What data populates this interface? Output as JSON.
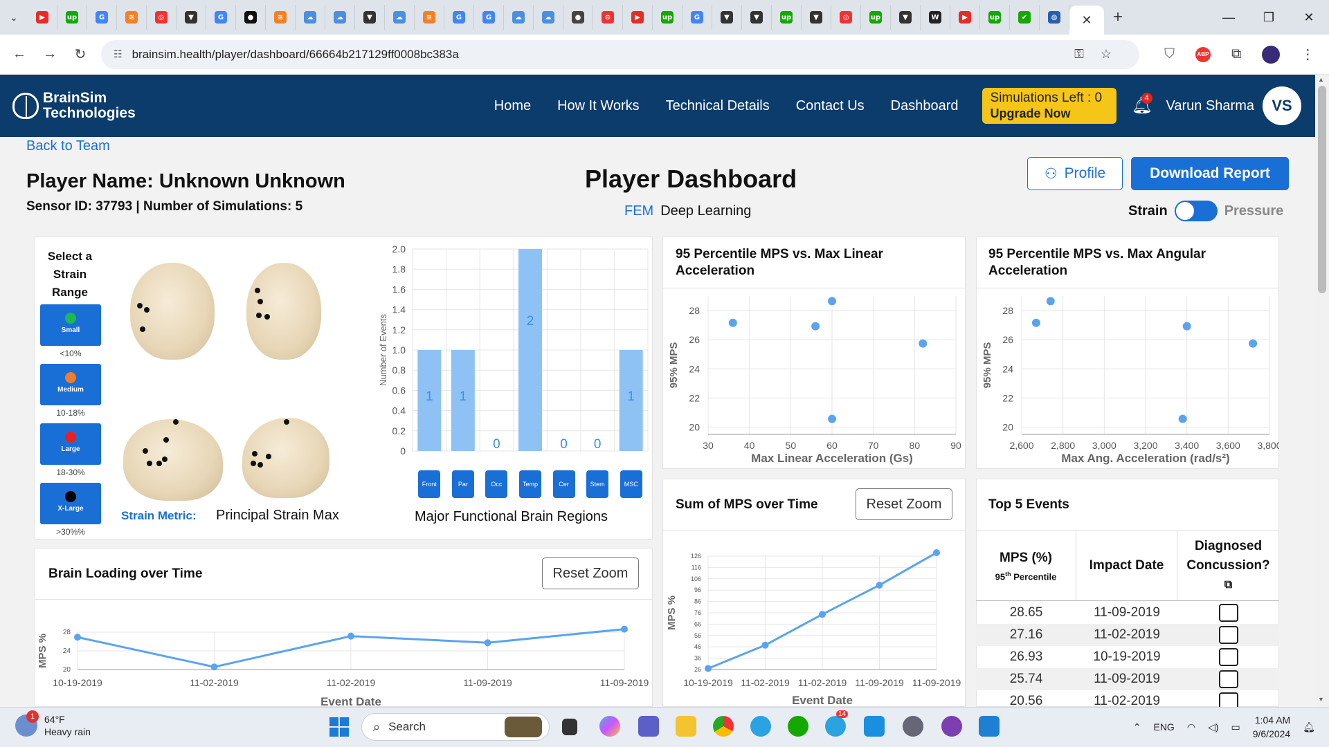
{
  "browser": {
    "url": "brainsim.health/player/dashboard/66664b217129ff0008bc383a",
    "active_tab_close": "✕",
    "new_tab": "+",
    "favicons": [
      {
        "icon": "youtube-icon",
        "color": "#e52d27",
        "glyph": "▶"
      },
      {
        "icon": "upwork-icon",
        "color": "#14a800",
        "glyph": "up"
      },
      {
        "icon": "google-icon",
        "color": "#4285f4",
        "glyph": "G"
      },
      {
        "icon": "stack-icon",
        "color": "#f48024",
        "glyph": "≋"
      },
      {
        "icon": "orbit-icon",
        "color": "#e33",
        "glyph": "◎"
      },
      {
        "icon": "vector-icon",
        "color": "#333",
        "glyph": "▼"
      },
      {
        "icon": "google-icon",
        "color": "#4285f4",
        "glyph": "G"
      },
      {
        "icon": "github-icon",
        "color": "#111",
        "glyph": "●"
      },
      {
        "icon": "stack-icon",
        "color": "#f48024",
        "glyph": "≋"
      },
      {
        "icon": "cloud-icon",
        "color": "#4a8fe0",
        "glyph": "☁"
      },
      {
        "icon": "cloud-icon",
        "color": "#4a8fe0",
        "glyph": "☁"
      },
      {
        "icon": "vector-icon",
        "color": "#333",
        "glyph": "▼"
      },
      {
        "icon": "cloud-icon",
        "color": "#4a8fe0",
        "glyph": "☁"
      },
      {
        "icon": "stack-icon",
        "color": "#f48024",
        "glyph": "≋"
      },
      {
        "icon": "google-icon",
        "color": "#4285f4",
        "glyph": "G"
      },
      {
        "icon": "google-icon",
        "color": "#4285f4",
        "glyph": "G"
      },
      {
        "icon": "cloud-icon",
        "color": "#4a8fe0",
        "glyph": "☁"
      },
      {
        "icon": "cloud-icon",
        "color": "#4a8fe0",
        "glyph": "☁"
      },
      {
        "icon": "globe-icon",
        "color": "#444",
        "glyph": "●"
      },
      {
        "icon": "chat-icon",
        "color": "#e33",
        "glyph": "⊝"
      },
      {
        "icon": "youtube-icon",
        "color": "#e52d27",
        "glyph": "▶"
      },
      {
        "icon": "upwork-icon",
        "color": "#14a800",
        "glyph": "up"
      },
      {
        "icon": "google-icon",
        "color": "#4285f4",
        "glyph": "G"
      },
      {
        "icon": "vector-icon",
        "color": "#333",
        "glyph": "▼"
      },
      {
        "icon": "vector-icon",
        "color": "#333",
        "glyph": "▼"
      },
      {
        "icon": "upwork-icon",
        "color": "#14a800",
        "glyph": "up"
      },
      {
        "icon": "vector-icon",
        "color": "#333",
        "glyph": "▼"
      },
      {
        "icon": "orbit-icon",
        "color": "#e33",
        "glyph": "◎"
      },
      {
        "icon": "upwork-icon",
        "color": "#14a800",
        "glyph": "up"
      },
      {
        "icon": "vector-icon",
        "color": "#333",
        "glyph": "▼"
      },
      {
        "icon": "wikipedia-icon",
        "color": "#222",
        "glyph": "W"
      },
      {
        "icon": "youtube-icon",
        "color": "#e52d27",
        "glyph": "▶"
      },
      {
        "icon": "upwork-icon",
        "color": "#14a800",
        "glyph": "up"
      },
      {
        "icon": "check-icon",
        "color": "#14a800",
        "glyph": "✔"
      },
      {
        "icon": "globe-icon",
        "color": "#2a5db0",
        "glyph": "◍"
      }
    ]
  },
  "header": {
    "logo_line1": "BrainSim",
    "logo_line2": "Technologies",
    "nav": [
      "Home",
      "How It Works",
      "Technical Details",
      "Contact Us",
      "Dashboard"
    ],
    "simulations_left": "Simulations Left : 0",
    "upgrade": "Upgrade Now",
    "notifications": "4",
    "user_name": "Varun Sharma",
    "user_initials": "VS",
    "colors": {
      "bar": "#0b3c6b",
      "accent": "#f5c518",
      "primary": "#1a6fd6"
    }
  },
  "page": {
    "back_link": "Back to Team",
    "player_name": "Player Name: Unknown Unknown",
    "sensor_line": "Sensor ID: 37793 | Number of Simulations: 5",
    "dashboard_title": "Player Dashboard",
    "mode_fem": "FEM",
    "mode_dl": "Deep Learning",
    "profile_btn": "Profile",
    "download_btn": "Download Report",
    "toggle_left": "Strain",
    "toggle_right": "Pressure",
    "toggle_state": "Strain"
  },
  "strain_panel": {
    "select_title": "Select a Strain Range",
    "ranges": [
      {
        "label": "Small",
        "caption": "<10%",
        "color": "#1db954"
      },
      {
        "label": "Medium",
        "caption": "10-18%",
        "color": "#f07d2c"
      },
      {
        "label": "Large",
        "caption": "18-30%",
        "color": "#e82020"
      },
      {
        "label": "X-Large",
        "caption": ">30%%",
        "color": "#000000"
      }
    ],
    "metric_label": "Strain Metric:",
    "metric_value": "Principal Strain Max",
    "regions_caption": "Major Functional Brain Regions",
    "regions": [
      "Front",
      "Par",
      "Occ",
      "Temp",
      "Cer",
      "Stem",
      "MSC"
    ]
  },
  "region_chart": {
    "ylabel": "Number of Events",
    "yticks": [
      "2.0",
      "1.8",
      "1.6",
      "1.4",
      "1.2",
      "1.0",
      "0.8",
      "0.6",
      "0.4",
      "0.2",
      "0"
    ]
  },
  "cards": {
    "linear_title": "95 Percentile MPS vs. Max Linear Acceleration",
    "angular_title": "95 Percentile MPS vs. Max Angular Acceleration",
    "sum_title": "Sum of MPS over Time",
    "loading_title": "Brain Loading over Time",
    "reset_zoom": "Reset Zoom",
    "top5_title": "Top 5 Events"
  },
  "chart_data": [
    {
      "id": "regions",
      "type": "bar",
      "categories": [
        "Front",
        "Par",
        "Occ",
        "Temp",
        "Cer",
        "Stem",
        "MSC"
      ],
      "values": [
        1,
        1,
        0,
        2,
        0,
        0,
        1
      ],
      "ylabel": "Number of Events",
      "ylim": [
        0,
        2
      ]
    },
    {
      "id": "linear",
      "type": "scatter",
      "x": [
        36,
        56,
        60,
        60,
        82
      ],
      "y": [
        27.16,
        26.93,
        28.65,
        20.56,
        25.74
      ],
      "xlabel": "Max Linear Acceleration (Gs)",
      "ylabel": "95% MPS",
      "xticks": [
        "30",
        "40",
        "50",
        "60",
        "70",
        "80",
        "90"
      ],
      "yticks": [
        "28",
        "26",
        "24",
        "22",
        "20"
      ],
      "xlim": [
        30,
        90
      ],
      "ylim": [
        19.5,
        29
      ]
    },
    {
      "id": "angular",
      "type": "scatter",
      "x": [
        2670,
        2740,
        3380,
        3400,
        3720
      ],
      "y": [
        27.16,
        28.65,
        20.56,
        26.93,
        25.74
      ],
      "xlabel": "Max Ang. Acceleration (rad/s²)",
      "ylabel": "95% MPS",
      "xticks": [
        "2,600",
        "2,800",
        "3,000",
        "3,200",
        "3,400",
        "3,600",
        "3,800"
      ],
      "yticks": [
        "28",
        "26",
        "24",
        "22",
        "20"
      ],
      "xlim": [
        2600,
        3800
      ],
      "ylim": [
        19.5,
        29
      ]
    },
    {
      "id": "sum",
      "type": "line",
      "x": [
        "10-19-2019",
        "11-02-2019",
        "11-02-2019",
        "11-09-2019",
        "11-09-2019"
      ],
      "y": [
        26.93,
        47.49,
        74.65,
        100.39,
        129.04
      ],
      "xlabel": "Event Date",
      "ylabel": "MPS %",
      "yticks": [
        "126",
        "116",
        "106",
        "96",
        "86",
        "76",
        "66",
        "56",
        "46",
        "36",
        "26"
      ],
      "ylim": [
        26,
        126
      ]
    },
    {
      "id": "loading",
      "type": "line",
      "x": [
        "10-19-2019",
        "11-02-2019",
        "11-02-2019",
        "11-09-2019",
        "11-09-2019"
      ],
      "y": [
        26.93,
        20.56,
        27.16,
        25.74,
        28.65
      ],
      "xlabel": "Event Date",
      "ylabel": "MPS %",
      "yticks": [
        "28",
        "24",
        "20"
      ],
      "ylim": [
        20,
        28
      ]
    }
  ],
  "top5": {
    "col1": "MPS (%)",
    "col1_sub": "95",
    "col1_sup": "th",
    "col1_sub2": " Percentile",
    "col2": "Impact Date",
    "col3": "Diagnosed Concussion?",
    "rows": [
      {
        "mps": "28.65",
        "date": "11-09-2019"
      },
      {
        "mps": "27.16",
        "date": "11-02-2019"
      },
      {
        "mps": "26.93",
        "date": "10-19-2019"
      },
      {
        "mps": "25.74",
        "date": "11-09-2019"
      },
      {
        "mps": "20.56",
        "date": "11-02-2019"
      }
    ]
  },
  "taskbar": {
    "weather_temp": "64°F",
    "weather_desc": "Heavy rain",
    "weather_badge": "1",
    "search": "Search",
    "lang": "ENG",
    "time": "1:04 AM",
    "date": "9/6/2024",
    "telegram_badge": "14"
  }
}
